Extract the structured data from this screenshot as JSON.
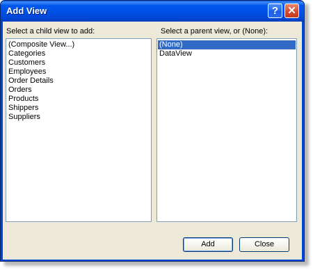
{
  "window": {
    "title": "Add View",
    "help_glyph": "?",
    "close_glyph": "✕"
  },
  "child_list": {
    "label": "Select a child view to add:",
    "items": [
      "(Composite View...)",
      "Categories",
      "Customers",
      "Employees",
      "Order Details",
      "Orders",
      "Products",
      "Shippers",
      "Suppliers"
    ]
  },
  "parent_list": {
    "label": "Select a parent view, or (None):",
    "items": [
      "(None)",
      "DataView"
    ],
    "selected": "(None)"
  },
  "buttons": {
    "add": "Add",
    "close": "Close"
  },
  "colors": {
    "titlebar": "#0058ee",
    "selection": "#316ac5",
    "dialog_bg": "#ece9d8"
  }
}
